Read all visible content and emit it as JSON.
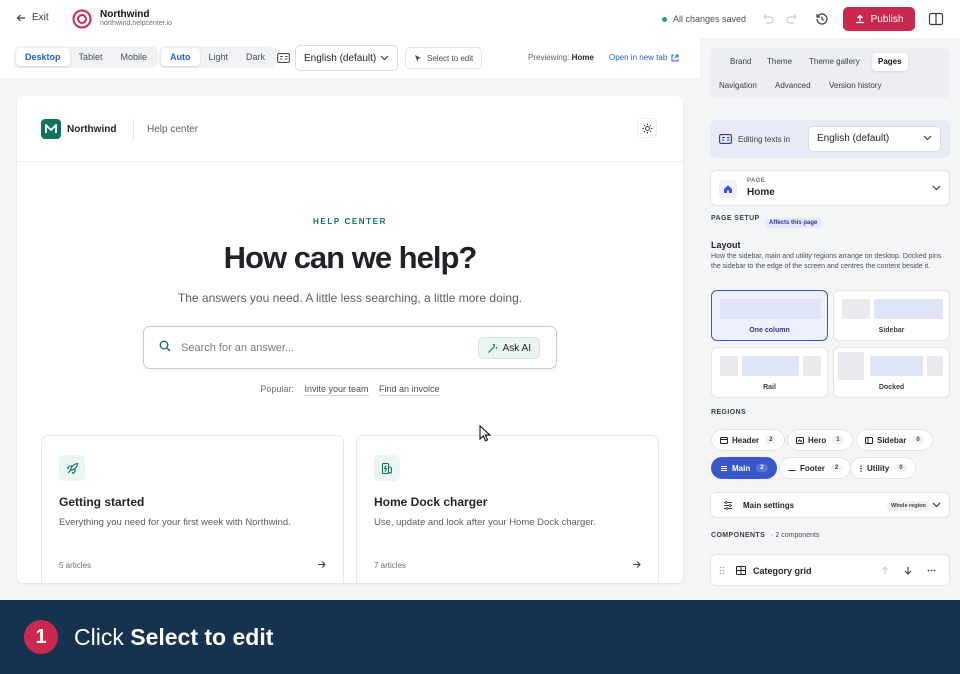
{
  "topbar": {
    "exit_label": "Exit",
    "brand_name": "Northwind",
    "brand_url": "northwind.helpcenter.io",
    "status_text": "All changes saved",
    "publish_label": "Publish"
  },
  "toolbar": {
    "devices": [
      "Desktop",
      "Tablet",
      "Mobile"
    ],
    "device_selected": "Desktop",
    "themes": [
      "Auto",
      "Light",
      "Dark"
    ],
    "theme_selected": "Auto",
    "language_value": "English (default)",
    "select_edit_label": "Select to edit",
    "previewing_label": "Previewing:",
    "previewing_page": "Home",
    "open_tab_label": "Open in new tab"
  },
  "preview": {
    "brand": "Northwind",
    "help_link": "Help center",
    "eyebrow": "HELP CENTER",
    "title": "How can we help?",
    "subtitle": "The answers you need. A little less searching, a little more doing.",
    "search_placeholder": "Search for an answer...",
    "ask_ai_label": "Ask AI",
    "popular_label": "Popular:",
    "popular_links": [
      "Invite your team",
      "Find an invoice"
    ],
    "cards": [
      {
        "title": "Getting started",
        "desc": "Everything you need for your first week with Northwind.",
        "count": "5 articles",
        "icon": "rocket-icon"
      },
      {
        "title": "Home Dock charger",
        "desc": "Use, update and look after your Home Dock charger.",
        "count": "7 articles",
        "icon": "ev-charger-icon"
      }
    ]
  },
  "panel": {
    "tabs_row1": [
      "Brand",
      "Theme",
      "Theme gallery",
      "Pages"
    ],
    "tabs_row2": [
      "Navigation",
      "Advanced",
      "Version history"
    ],
    "tab_selected": "Pages",
    "editing_texts_label": "Editing texts in",
    "editing_language": "English (default)",
    "page_key": "PAGE",
    "page_value": "Home",
    "page_setup_label": "PAGE SETUP",
    "page_setup_badge": "Affects this page",
    "layout_heading": "Layout",
    "layout_desc": "How the sidebar, main and utility regions arrange on desktop. Docked pins the sidebar to the edge of the screen and centres the content beside it.",
    "layouts": [
      "One column",
      "Sidebar",
      "Rail",
      "Docked"
    ],
    "layout_selected": "One column",
    "regions_label": "REGIONS",
    "regions": [
      {
        "name": "Header",
        "count": "2"
      },
      {
        "name": "Hero",
        "count": "1"
      },
      {
        "name": "Sidebar",
        "count": "0"
      },
      {
        "name": "Main",
        "count": "2"
      },
      {
        "name": "Footer",
        "count": "2"
      },
      {
        "name": "Utility",
        "count": "0"
      }
    ],
    "region_selected": "Main",
    "main_settings_label": "Main settings",
    "main_settings_badge": "Whole region",
    "components_label": "COMPONENTS",
    "components_count": "2 components",
    "component_name": "Category grid"
  },
  "caption": {
    "step": "1",
    "prefix": "Click",
    "target": "Select to edit"
  },
  "colors": {
    "accent_blue": "#2563c9",
    "publish_red": "#c9294f",
    "brand_green": "#13725d",
    "caption_bg": "#17324f",
    "region_selected": "#3b58c9"
  }
}
